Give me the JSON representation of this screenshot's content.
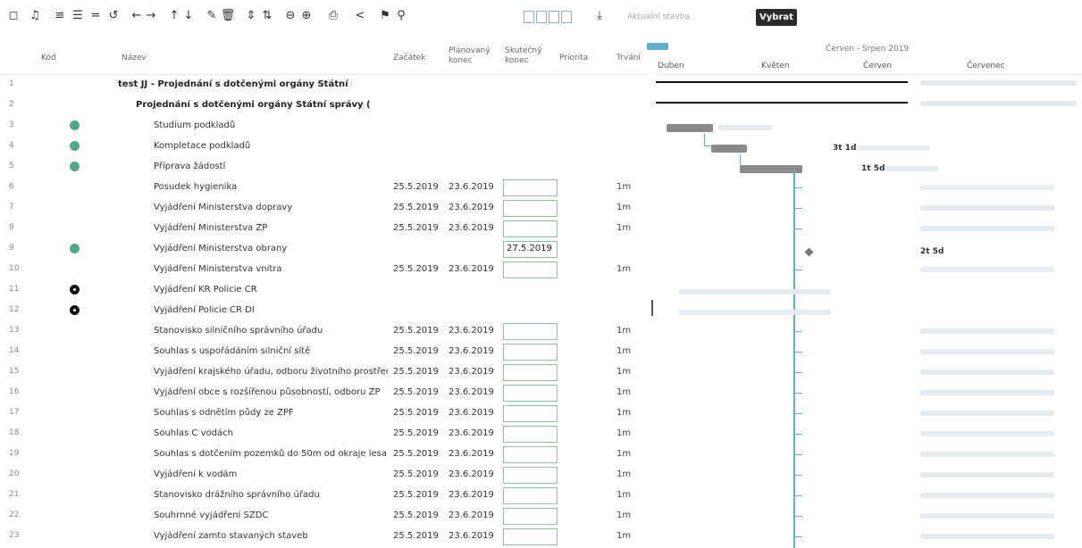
{
  "toolbar": {
    "select_value": "Aktuální stavba",
    "select_button_label": "Vybrat",
    "icons": [
      "square-icon",
      "bell-icon",
      "indent-icon",
      "list-icon",
      "undo-icon",
      "horizontal-arrows-icon",
      "vertical-arrows-icon",
      "edit-icon",
      "delete-icon",
      "align-icon",
      "sort-icon",
      "zoom-out-icon",
      "zoom-in-icon",
      "print-icon",
      "share-icon",
      "link-icon",
      "filter-boxes-icon",
      "download-icon"
    ]
  },
  "grid": {
    "headers": {
      "code": "Kód",
      "name": "Název",
      "start": "Začátek",
      "planned_end": "Plánovaný konec",
      "actual_end": "Skutečný konec",
      "priority": "Priorita",
      "duration": "Trvání"
    },
    "rows": [
      {
        "num": "1",
        "name": "test JJ - Projednání s dotčenými orgány Státní správy (D",
        "level": 1,
        "start": "",
        "end": "",
        "dur": "",
        "status": "",
        "actual": false,
        "actual_val": ""
      },
      {
        "num": "2",
        "name": "Projednání s dotčenými orgány Státní správy (DOSS)",
        "level": 2,
        "start": "",
        "end": "",
        "dur": "",
        "status": "",
        "actual": false,
        "actual_val": ""
      },
      {
        "num": "3",
        "name": "Studium podkladů",
        "level": 3,
        "start": "",
        "end": "",
        "dur": "",
        "status": "done",
        "actual": false,
        "actual_val": ""
      },
      {
        "num": "4",
        "name": "Kompletace podkladů",
        "level": 3,
        "start": "",
        "end": "",
        "dur": "",
        "status": "done",
        "actual": false,
        "actual_val": ""
      },
      {
        "num": "5",
        "name": "Příprava žádostí",
        "level": 3,
        "start": "",
        "end": "",
        "dur": "",
        "status": "done",
        "actual": false,
        "actual_val": ""
      },
      {
        "num": "6",
        "name": "Posudek hygienika",
        "level": 3,
        "start": "25.5.2019",
        "end": "23.6.2019",
        "dur": "1m",
        "status": "",
        "actual": true,
        "actual_val": ""
      },
      {
        "num": "7",
        "name": "Vyjádření Ministerstva dopravy",
        "level": 3,
        "start": "25.5.2019",
        "end": "23.6.2019",
        "dur": "1m",
        "status": "",
        "actual": true,
        "actual_val": ""
      },
      {
        "num": "8",
        "name": "Vyjádření Ministerstva ŽP",
        "level": 3,
        "start": "25.5.2019",
        "end": "23.6.2019",
        "dur": "1m",
        "status": "",
        "actual": true,
        "actual_val": ""
      },
      {
        "num": "9",
        "name": "Vyjádření Ministerstva obrany",
        "level": 3,
        "start": "",
        "end": "",
        "dur": "",
        "status": "done",
        "actual": true,
        "actual_val": "27.5.2019"
      },
      {
        "num": "10",
        "name": "Vyjádření Ministerstva vnitra",
        "level": 3,
        "start": "25.5.2019",
        "end": "23.6.2019",
        "dur": "1m",
        "status": "",
        "actual": true,
        "actual_val": ""
      },
      {
        "num": "11",
        "name": "Vyjádření KŘ Policie ČR",
        "level": 3,
        "start": "",
        "end": "",
        "dur": "",
        "status": "warn",
        "actual": false,
        "actual_val": ""
      },
      {
        "num": "12",
        "name": "Vyjádření Policie ČR DI",
        "level": 3,
        "start": "",
        "end": "",
        "dur": "",
        "status": "warn",
        "actual": false,
        "actual_val": ""
      },
      {
        "num": "13",
        "name": "Stanovisko silničního správního úřadu",
        "level": 3,
        "start": "25.5.2019",
        "end": "23.6.2019",
        "dur": "1m",
        "status": "",
        "actual": true,
        "actual_val": ""
      },
      {
        "num": "14",
        "name": "Souhlas s uspořádáním silniční sítě",
        "level": 3,
        "start": "25.5.2019",
        "end": "23.6.2019",
        "dur": "1m",
        "status": "",
        "actual": true,
        "actual_val": ""
      },
      {
        "num": "15",
        "name": "Vyjádření krajského úřadu, odboru životního prostředí",
        "level": 3,
        "start": "25.5.2019",
        "end": "23.6.2019",
        "dur": "1m",
        "status": "",
        "actual": true,
        "actual_val": ""
      },
      {
        "num": "16",
        "name": "Vyjádření obce s rozšířenou působností, odboru ŽP",
        "level": 3,
        "start": "25.5.2019",
        "end": "23.6.2019",
        "dur": "1m",
        "status": "",
        "actual": true,
        "actual_val": ""
      },
      {
        "num": "17",
        "name": "Souhlas s odnětím půdy ze ZPF",
        "level": 3,
        "start": "25.5.2019",
        "end": "23.6.2019",
        "dur": "1m",
        "status": "",
        "actual": true,
        "actual_val": ""
      },
      {
        "num": "18",
        "name": "Souhlas C vodách",
        "level": 3,
        "start": "25.5.2019",
        "end": "23.6.2019",
        "dur": "1m",
        "status": "",
        "actual": true,
        "actual_val": ""
      },
      {
        "num": "19",
        "name": "Souhlas s dotčením pozemků do 50m od okraje lesa",
        "level": 3,
        "start": "25.5.2019",
        "end": "23.6.2019",
        "dur": "1m",
        "status": "",
        "actual": true,
        "actual_val": ""
      },
      {
        "num": "20",
        "name": "Vyjádření k vodám",
        "level": 3,
        "start": "25.5.2019",
        "end": "23.6.2019",
        "dur": "1m",
        "status": "",
        "actual": true,
        "actual_val": ""
      },
      {
        "num": "21",
        "name": "Stanovisko drážního správního úřadu",
        "level": 3,
        "start": "25.5.2019",
        "end": "23.6.2019",
        "dur": "1m",
        "status": "",
        "actual": true,
        "actual_val": ""
      },
      {
        "num": "22",
        "name": "Souhrnné vyjádření SŽDC",
        "level": 3,
        "start": "25.5.2019",
        "end": "23.6.2019",
        "dur": "1m",
        "status": "",
        "actual": true,
        "actual_val": ""
      },
      {
        "num": "23",
        "name": "Vyjádření zamto stavaných staveb",
        "level": 3,
        "start": "25.5.2019",
        "end": "23.6.2019",
        "dur": "1m",
        "status": "",
        "actual": true,
        "actual_val": ""
      }
    ]
  },
  "gantt": {
    "header_top": "Červen - Srpen 2019",
    "months": [
      "Duben",
      "Květen",
      "Červen",
      "Červenec"
    ],
    "duration_labels": [
      "3t 1d",
      "1t 5d",
      "2t 5d"
    ]
  }
}
